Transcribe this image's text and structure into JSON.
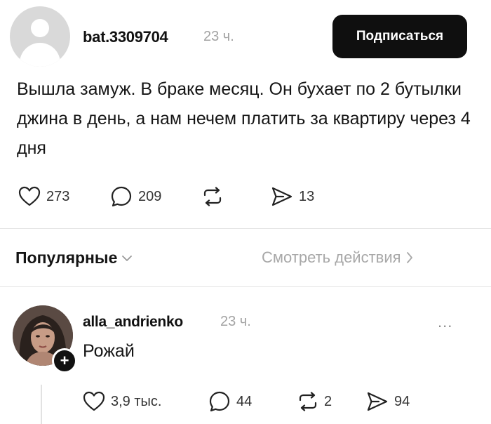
{
  "post": {
    "username": "bat.3309704",
    "time": "23 ч.",
    "subscribe_label": "Подписаться",
    "text": "Вышла замуж. В браке месяц. Он бухает по 2 бутылки джина в день, а нам нечем платить за квартиру через 4 дня",
    "likes": "273",
    "comments": "209",
    "shares": "13"
  },
  "filter": {
    "popular_label": "Популярные",
    "view_actions_label": "Смотреть действия"
  },
  "comment": {
    "username": "alla_andrienko",
    "time": "23 ч.",
    "more": "...",
    "text": "Рожай",
    "likes": "3,9 тыс.",
    "comments": "44",
    "reposts": "2",
    "shares": "94"
  },
  "icons": [
    "heart-icon",
    "comment-icon",
    "repost-icon",
    "share-icon",
    "chevron-down-icon",
    "chevron-right-icon",
    "plus-icon"
  ]
}
